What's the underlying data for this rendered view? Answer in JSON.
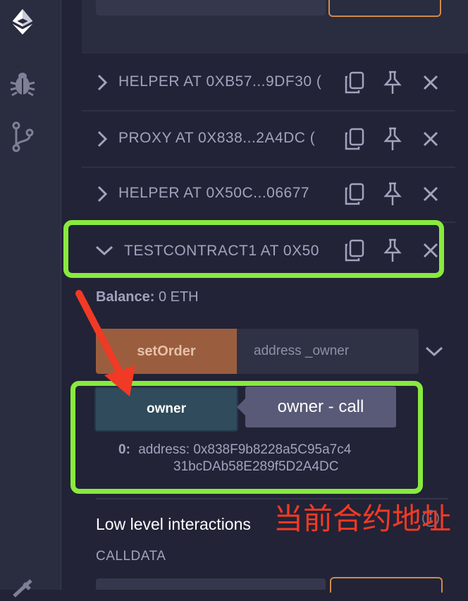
{
  "sidebar": {
    "icons": [
      "remix-logo-icon",
      "debugger-bug-icon",
      "git-branch-icon",
      "plugin-icon"
    ]
  },
  "contracts": [
    {
      "title": "HELPER AT 0XB57...9DF30 (",
      "expanded": false
    },
    {
      "title": "PROXY AT 0X838...2A4DC (",
      "expanded": false
    },
    {
      "title": "HELPER AT 0X50C...06677",
      "expanded": false
    },
    {
      "title": "TESTCONTRACT1 AT 0X50",
      "expanded": true
    }
  ],
  "expanded_contract": {
    "balance_label": "Balance:",
    "balance_value": "0 ETH",
    "setorder_label": "setOrder",
    "setorder_placeholder": "address _owner",
    "owner_label": "owner",
    "tooltip": "owner - call",
    "result_index": "0:",
    "result_line1": "address: 0x838F9b8228a5C95a7c4",
    "result_line2": "31bcDAb58E289f5D2A4DC"
  },
  "low_level": {
    "heading": "Low level interactions",
    "calldata_label": "CALLDATA"
  },
  "annotation": {
    "text": "当前合约地址",
    "color": "#f03a25"
  },
  "colors": {
    "highlight": "#88ea3e",
    "setorder_button": "#9a5e3f",
    "owner_button": "#2f4b5c",
    "background": "#222336"
  }
}
